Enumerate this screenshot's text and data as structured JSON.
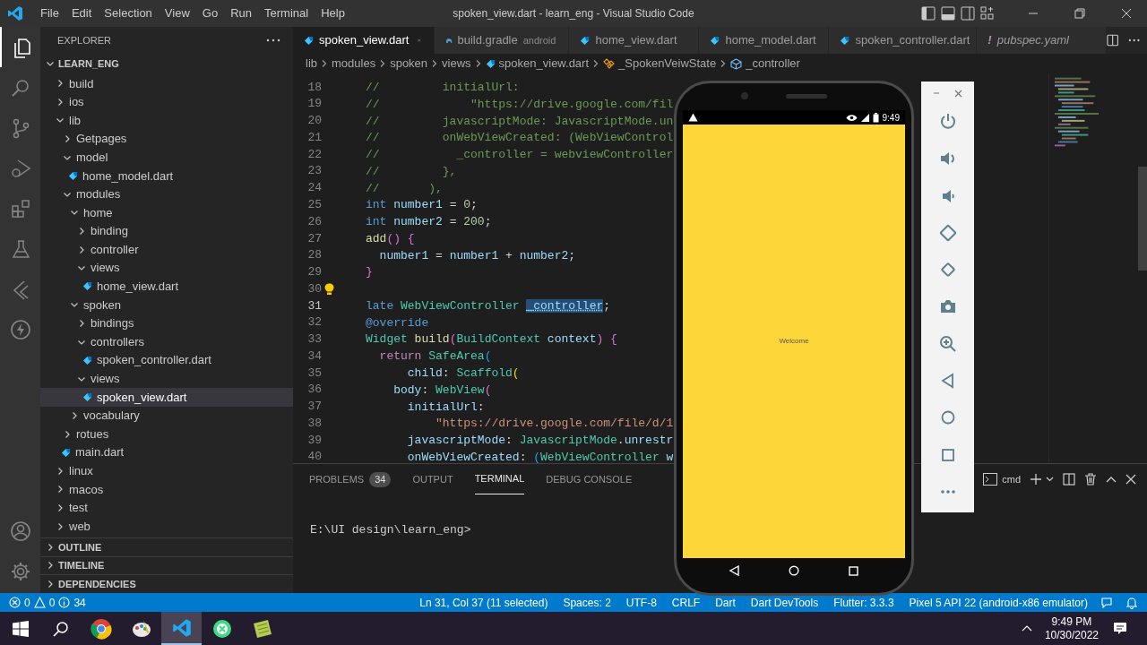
{
  "window": {
    "title": "spoken_view.dart - learn_eng - Visual Studio Code"
  },
  "menu": [
    "File",
    "Edit",
    "Selection",
    "View",
    "Go",
    "Run",
    "Terminal",
    "Help"
  ],
  "sidebar": {
    "title": "EXPLORER",
    "root": {
      "label": "LEARN_ENG",
      "expanded": true
    },
    "tree": [
      {
        "label": "build",
        "kind": "folder",
        "expanded": false,
        "selected": false
      },
      {
        "label": "ios",
        "kind": "folder",
        "expanded": false,
        "selected": false
      },
      {
        "label": "lib",
        "kind": "folder",
        "expanded": true,
        "selected": false,
        "children": [
          {
            "label": "Getpages",
            "kind": "folder",
            "expanded": false,
            "selected": false
          },
          {
            "label": "model",
            "kind": "folder",
            "expanded": true,
            "selected": false,
            "children": [
              {
                "label": "home_model.dart",
                "kind": "file",
                "selected": false
              }
            ]
          },
          {
            "label": "modules",
            "kind": "folder",
            "expanded": true,
            "selected": false,
            "children": [
              {
                "label": "home",
                "kind": "folder",
                "expanded": true,
                "selected": false,
                "children": [
                  {
                    "label": "binding",
                    "kind": "folder",
                    "expanded": false,
                    "selected": false
                  },
                  {
                    "label": "controller",
                    "kind": "folder",
                    "expanded": false,
                    "selected": false
                  },
                  {
                    "label": "views",
                    "kind": "folder",
                    "expanded": true,
                    "selected": false,
                    "children": [
                      {
                        "label": "home_view.dart",
                        "kind": "file",
                        "selected": false
                      }
                    ]
                  }
                ]
              },
              {
                "label": "spoken",
                "kind": "folder",
                "expanded": true,
                "selected": false,
                "children": [
                  {
                    "label": "bindings",
                    "kind": "folder",
                    "expanded": false,
                    "selected": false
                  },
                  {
                    "label": "controllers",
                    "kind": "folder",
                    "expanded": true,
                    "selected": false,
                    "children": [
                      {
                        "label": "spoken_controller.dart",
                        "kind": "file",
                        "selected": false
                      }
                    ]
                  },
                  {
                    "label": "views",
                    "kind": "folder",
                    "expanded": true,
                    "selected": false,
                    "children": [
                      {
                        "label": "spoken_view.dart",
                        "kind": "file",
                        "selected": true
                      }
                    ]
                  }
                ]
              },
              {
                "label": "vocabulary",
                "kind": "folder",
                "expanded": false,
                "selected": false
              }
            ]
          },
          {
            "label": "rotues",
            "kind": "folder",
            "expanded": false,
            "selected": false
          },
          {
            "label": "main.dart",
            "kind": "file",
            "selected": false
          }
        ]
      },
      {
        "label": "linux",
        "kind": "folder",
        "expanded": false,
        "selected": false
      },
      {
        "label": "macos",
        "kind": "folder",
        "expanded": false,
        "selected": false
      },
      {
        "label": "test",
        "kind": "folder",
        "expanded": false,
        "selected": false
      },
      {
        "label": "web",
        "kind": "folder",
        "expanded": false,
        "selected": false
      }
    ],
    "sections": [
      {
        "label": "OUTLINE",
        "expanded": false
      },
      {
        "label": "TIMELINE",
        "expanded": false
      },
      {
        "label": "DEPENDENCIES",
        "expanded": false
      }
    ]
  },
  "tabs": [
    {
      "label": "spoken_view.dart",
      "kind": "dart",
      "selected": true
    },
    {
      "label": "build.gradle",
      "description": "android",
      "kind": "gradle",
      "selected": false
    },
    {
      "label": "home_view.dart",
      "kind": "dart",
      "selected": false
    },
    {
      "label": "home_model.dart",
      "kind": "dart",
      "selected": false
    },
    {
      "label": "spoken_controller.dart",
      "kind": "dart",
      "selected": false
    },
    {
      "label": "pubspec.yaml",
      "marker": "!",
      "kind": "yaml",
      "selected": false
    }
  ],
  "breadcrumbs": [
    {
      "text": "lib",
      "kind": "folder"
    },
    {
      "text": "modules",
      "kind": "folder"
    },
    {
      "text": "spoken",
      "kind": "folder"
    },
    {
      "text": "views",
      "kind": "folder"
    },
    {
      "text": "spoken_view.dart",
      "kind": "file"
    },
    {
      "text": "_SpokenVeiwState",
      "kind": "class"
    },
    {
      "text": "_controller",
      "kind": "field"
    }
  ],
  "editor": {
    "lines": [
      {
        "number": "18",
        "current": false,
        "lightbulb": false,
        "tokens": [
          {
            "kind": "comment",
            "text": "//         initialUrl:"
          }
        ]
      },
      {
        "number": "19",
        "current": false,
        "lightbulb": false,
        "tokens": [
          {
            "kind": "comment",
            "text": "//             \"https://drive.google.com/fil"
          }
        ]
      },
      {
        "number": "20",
        "current": false,
        "lightbulb": false,
        "tokens": [
          {
            "kind": "comment",
            "text": "//         javascriptMode: JavascriptMode.un"
          }
        ]
      },
      {
        "number": "21",
        "current": false,
        "lightbulb": false,
        "tokens": [
          {
            "kind": "comment",
            "text": "//         onWebViewCreated: (WebViewControl"
          }
        ]
      },
      {
        "number": "22",
        "current": false,
        "lightbulb": false,
        "tokens": [
          {
            "kind": "comment",
            "text": "//           _controller = webviewController"
          }
        ]
      },
      {
        "number": "23",
        "current": false,
        "lightbulb": false,
        "tokens": [
          {
            "kind": "comment",
            "text": "//         },"
          }
        ]
      },
      {
        "number": "24",
        "current": false,
        "lightbulb": false,
        "tokens": [
          {
            "kind": "comment",
            "text": "//       ),"
          }
        ]
      },
      {
        "number": "25",
        "current": false,
        "lightbulb": false,
        "tokens": [
          {
            "kind": "keyword",
            "text": "int"
          },
          {
            "kind": "variable",
            "text": " number1"
          },
          {
            "kind": "plain",
            "text": " = "
          },
          {
            "kind": "number",
            "text": "0"
          },
          {
            "kind": "plain",
            "text": ";"
          }
        ]
      },
      {
        "number": "26",
        "current": false,
        "lightbulb": false,
        "tokens": [
          {
            "kind": "keyword",
            "text": "int"
          },
          {
            "kind": "variable",
            "text": " number2"
          },
          {
            "kind": "plain",
            "text": " = "
          },
          {
            "kind": "number",
            "text": "200"
          },
          {
            "kind": "plain",
            "text": ";"
          }
        ]
      },
      {
        "number": "27",
        "current": false,
        "lightbulb": false,
        "tokens": [
          {
            "kind": "function",
            "text": "add"
          },
          {
            "kind": "bracket2",
            "text": "()"
          },
          {
            "kind": "bracket2",
            "text": " {"
          }
        ]
      },
      {
        "number": "28",
        "current": false,
        "lightbulb": false,
        "tokens": [
          {
            "kind": "variable",
            "text": "  number1"
          },
          {
            "kind": "plain",
            "text": " = "
          },
          {
            "kind": "variable",
            "text": "number1"
          },
          {
            "kind": "plain",
            "text": " + "
          },
          {
            "kind": "variable",
            "text": "number2"
          },
          {
            "kind": "plain",
            "text": ";"
          }
        ]
      },
      {
        "number": "29",
        "current": false,
        "lightbulb": false,
        "tokens": [
          {
            "kind": "bracket2",
            "text": "}"
          }
        ]
      },
      {
        "number": "30",
        "current": false,
        "lightbulb": true
      },
      {
        "number": "31",
        "current": true,
        "lightbulb": false,
        "tokens": [
          {
            "kind": "keyword",
            "text": "late"
          },
          {
            "kind": "type",
            "text": " WebViewController "
          },
          {
            "kind": "selection",
            "text": "_controller"
          },
          {
            "kind": "plain",
            "text": ";"
          }
        ]
      },
      {
        "number": "32",
        "current": false,
        "lightbulb": false,
        "tokens": [
          {
            "kind": "keyword",
            "text": "@override"
          }
        ]
      },
      {
        "number": "33",
        "current": false,
        "lightbulb": false,
        "tokens": [
          {
            "kind": "type",
            "text": "Widget"
          },
          {
            "kind": "function",
            "text": " build"
          },
          {
            "kind": "bracket2",
            "text": "("
          },
          {
            "kind": "type",
            "text": "BuildContext"
          },
          {
            "kind": "variable",
            "text": " context"
          },
          {
            "kind": "bracket2",
            "text": ")"
          },
          {
            "kind": "bracket2",
            "text": " {"
          }
        ]
      },
      {
        "number": "34",
        "current": false,
        "lightbulb": false,
        "tokens": [
          {
            "kind": "control",
            "text": "  return"
          },
          {
            "kind": "type",
            "text": " SafeArea"
          },
          {
            "kind": "bracket3",
            "text": "("
          }
        ]
      },
      {
        "number": "35",
        "current": false,
        "lightbulb": false,
        "tokens": [
          {
            "kind": "variable",
            "text": "      child"
          },
          {
            "kind": "plain",
            "text": ": "
          },
          {
            "kind": "type",
            "text": "Scaffold"
          },
          {
            "kind": "bracket1",
            "text": "("
          }
        ]
      },
      {
        "number": "36",
        "current": false,
        "lightbulb": false,
        "tokens": [
          {
            "kind": "variable",
            "text": "    body"
          },
          {
            "kind": "plain",
            "text": ": "
          },
          {
            "kind": "type",
            "text": "WebView"
          },
          {
            "kind": "bracket2",
            "text": "("
          }
        ]
      },
      {
        "number": "37",
        "current": false,
        "lightbulb": false,
        "tokens": [
          {
            "kind": "variable",
            "text": "      initialUrl"
          },
          {
            "kind": "plain",
            "text": ":"
          }
        ]
      },
      {
        "number": "38",
        "current": false,
        "lightbulb": false,
        "tokens": [
          {
            "kind": "string",
            "text": "          \"https://drive.google.com/file/d/1"
          }
        ]
      },
      {
        "number": "39",
        "current": false,
        "lightbulb": false,
        "tokens": [
          {
            "kind": "variable",
            "text": "      javascriptMode"
          },
          {
            "kind": "plain",
            "text": ": "
          },
          {
            "kind": "type",
            "text": "JavascriptMode"
          },
          {
            "kind": "plain",
            "text": "."
          },
          {
            "kind": "variable",
            "text": "unrestr"
          }
        ]
      },
      {
        "number": "40",
        "current": false,
        "lightbulb": false,
        "tokens": [
          {
            "kind": "variable",
            "text": "      onWebViewCreated"
          },
          {
            "kind": "plain",
            "text": ": "
          },
          {
            "kind": "bracket3",
            "text": "("
          },
          {
            "kind": "type",
            "text": "WebViewController"
          },
          {
            "kind": "variable",
            "text": " w"
          }
        ]
      }
    ]
  },
  "panel": {
    "tabs": [
      {
        "label": "PROBLEMS",
        "badge": "34",
        "selected": false
      },
      {
        "label": "OUTPUT",
        "selected": false
      },
      {
        "label": "TERMINAL",
        "selected": true
      },
      {
        "label": "DEBUG CONSOLE",
        "selected": false
      }
    ],
    "terminal_name": "cmd",
    "terminal_text": "E:\\UI design\\learn_eng>"
  },
  "phone": {
    "time": "9:49",
    "screen_text": "Welcome"
  },
  "status_bar": {
    "errors": "0",
    "warnings": "0",
    "infos": "34",
    "items": [
      "Ln 31, Col 37 (11 selected)",
      "Spaces: 2",
      "UTF-8",
      "CRLF",
      "Dart",
      "Dart DevTools",
      "Flutter: 3.3.3",
      "Pixel 5 API 22 (android-x86 emulator)"
    ]
  },
  "taskbar": {
    "apps": [
      {
        "kind": "start",
        "active": false
      },
      {
        "kind": "search",
        "active": false
      },
      {
        "kind": "browser",
        "active": false
      },
      {
        "kind": "paint",
        "active": false
      },
      {
        "kind": "code",
        "active": true
      },
      {
        "kind": "studio",
        "active": false
      },
      {
        "kind": "notes",
        "active": false
      }
    ],
    "time": "9:49 PM",
    "date": "10/30/2022"
  }
}
